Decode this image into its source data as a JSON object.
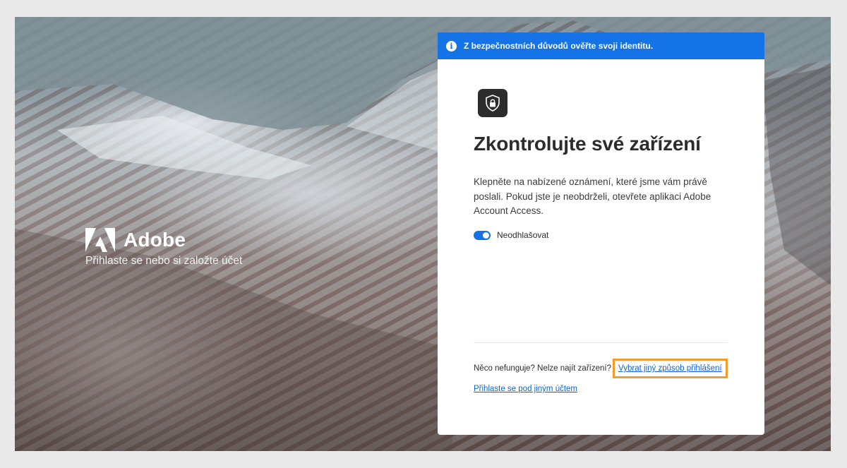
{
  "brand": {
    "name": "Adobe",
    "subtitle": "Přihlaste se nebo si založte účet"
  },
  "banner": {
    "icon": "info-icon",
    "text": "Z bezpečnostních důvodů ověřte svoji identitu."
  },
  "card": {
    "icon": "shield-lock-icon",
    "title": "Zkontrolujte své zařízení",
    "description": "Klepněte na nabízené oznámení, které jsme vám právě poslali. Pokud jste je neobdrželi, otevřete aplikaci Adobe Account Access.",
    "toggle": {
      "label": "Neodhlašovat",
      "on": true
    },
    "help_text": "Něco nefunguje? Nelze najít zařízení?",
    "other_method_link": "Vybrat jiný způsob přihlášení",
    "switch_account_link": "Přihlaste se pod jiným účtem"
  },
  "colors": {
    "accent": "#1473e6",
    "link": "#0d66d0",
    "highlight": "#f39c2c"
  }
}
